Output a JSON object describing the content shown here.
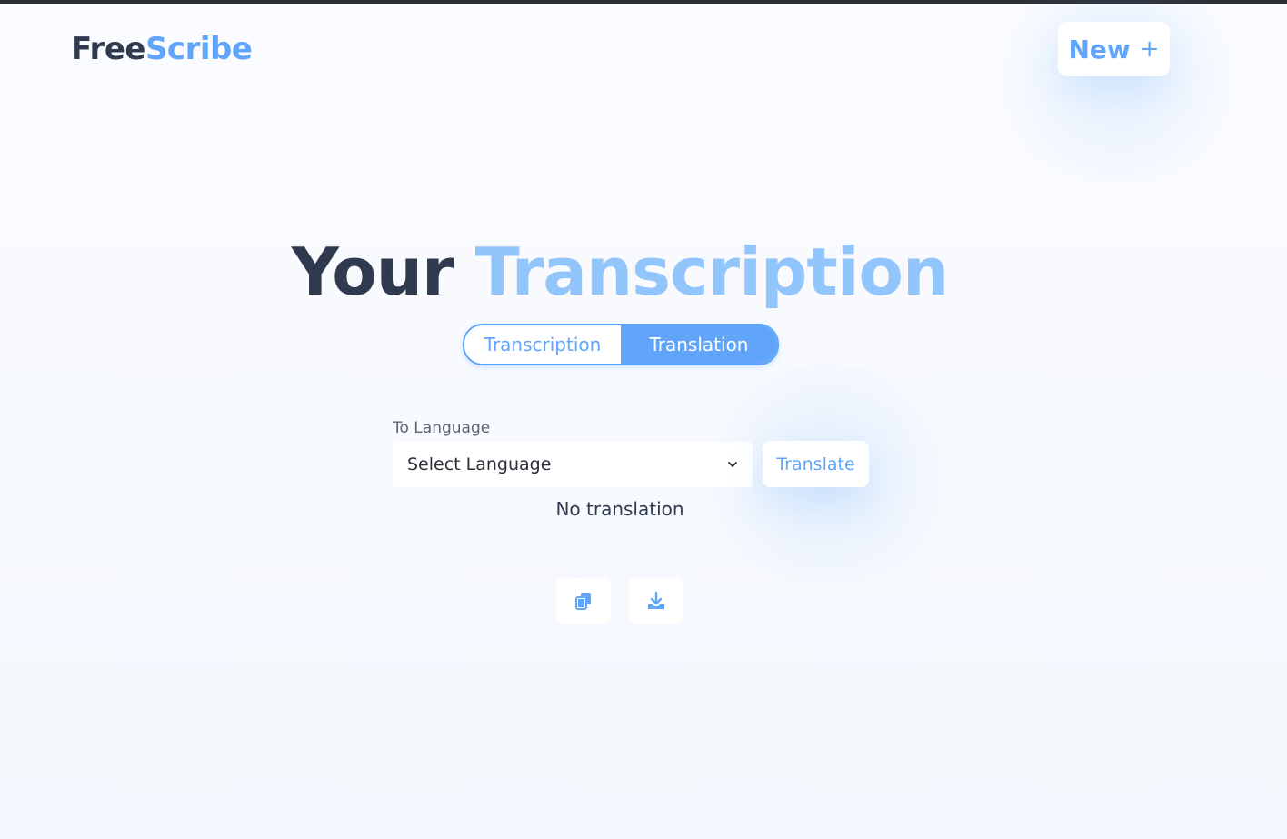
{
  "header": {
    "logo_part1": "Free",
    "logo_part2": "Scribe",
    "new_button_label": "New",
    "new_button_icon": "+"
  },
  "main": {
    "title_part1": "Your",
    "title_part2": "Transcription",
    "tabs": [
      {
        "label": "Transcription",
        "active": false
      },
      {
        "label": "Translation",
        "active": true
      }
    ],
    "to_language_label": "To Language",
    "language_select_value": "Select Language",
    "translate_button_label": "Translate",
    "status_text": "No translation",
    "actions": [
      {
        "icon": "copy-icon"
      },
      {
        "icon": "download-icon"
      }
    ]
  },
  "colors": {
    "accent": "#60a5fa",
    "accent_light": "#93c5fd",
    "dark_text": "#2f3a4e",
    "background": "#f6f9fe"
  }
}
